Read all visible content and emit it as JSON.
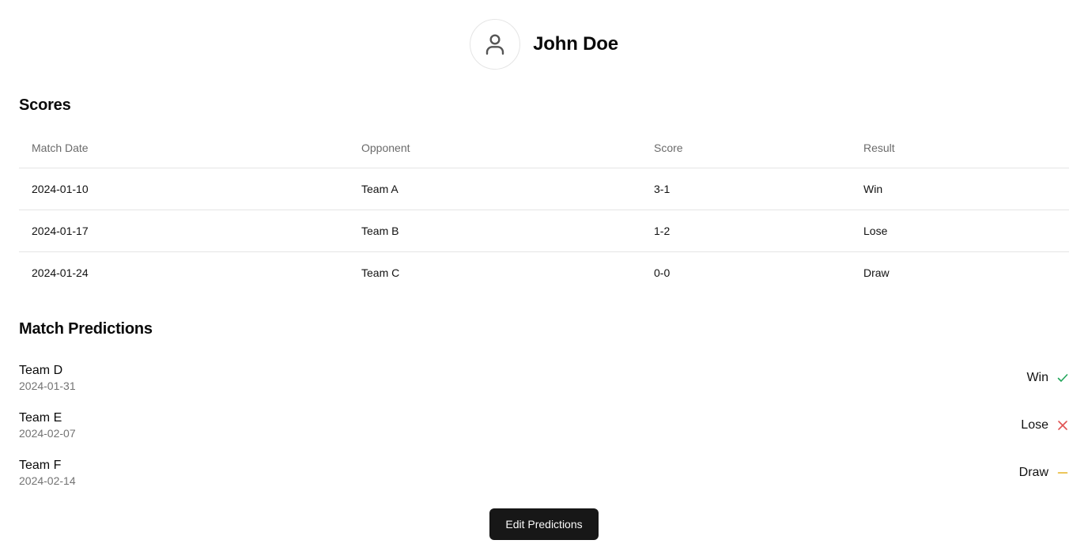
{
  "profile": {
    "name": "John Doe",
    "avatar_icon": "user-icon"
  },
  "scores": {
    "title": "Scores",
    "columns": [
      "Match Date",
      "Opponent",
      "Score",
      "Result"
    ],
    "rows": [
      {
        "date": "2024-01-10",
        "opponent": "Team A",
        "score": "3-1",
        "result": "Win"
      },
      {
        "date": "2024-01-17",
        "opponent": "Team B",
        "score": "1-2",
        "result": "Lose"
      },
      {
        "date": "2024-01-24",
        "opponent": "Team C",
        "score": "0-0",
        "result": "Draw"
      }
    ]
  },
  "predictions": {
    "title": "Match Predictions",
    "items": [
      {
        "team": "Team D",
        "date": "2024-01-31",
        "result": "Win",
        "icon": "check-icon",
        "icon_color": "#22a55a"
      },
      {
        "team": "Team E",
        "date": "2024-02-07",
        "result": "Lose",
        "icon": "x-icon",
        "icon_color": "#e05252"
      },
      {
        "team": "Team F",
        "date": "2024-02-14",
        "result": "Draw",
        "icon": "minus-icon",
        "icon_color": "#e6b325"
      }
    ]
  },
  "actions": {
    "edit_label": "Edit Predictions"
  }
}
